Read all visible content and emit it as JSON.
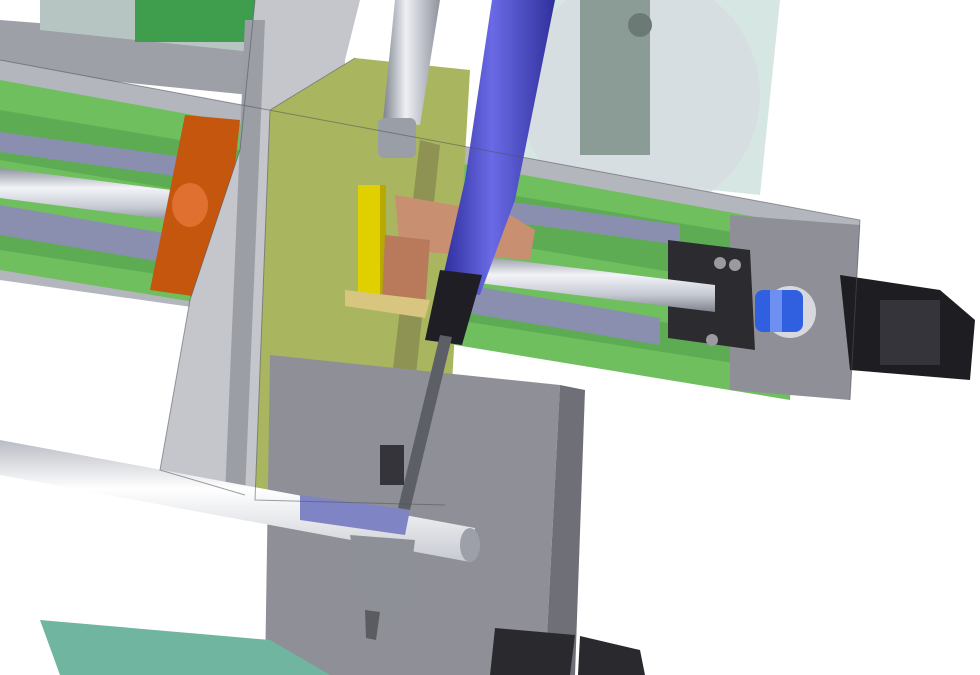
{
  "scene": {
    "kind": "cad-3d-render",
    "description_visible_text": "",
    "colors": {
      "background": "#ffffff",
      "frame_gray": "#bdbec4",
      "frame_dark": "#8f9097",
      "green_plate": "#6fbf5e",
      "green_dark": "#3f8f45",
      "olive_plate": "#a9b65f",
      "orange_block": "#c4560e",
      "copper_block": "#c89070",
      "yellow_cylinder": "#e0d000",
      "blue_handle": "#4a4ac8",
      "blue_coupling": "#3060e0",
      "motor_black": "#1e1e22",
      "rod_silver": "#c8ccd6",
      "teal_base": "#6fb5a0",
      "transparent_panel": "#cfe7e0"
    }
  }
}
